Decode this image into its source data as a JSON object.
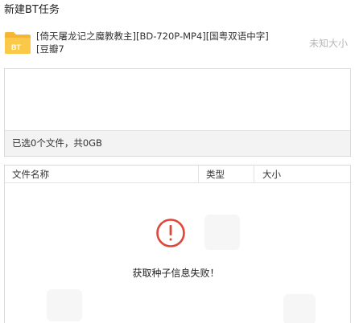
{
  "window": {
    "title": "新建BT任务"
  },
  "task": {
    "icon_label": "BT",
    "name": "[倚天屠龙记之魔教教主][BD-720P-MP4][国粤双语中字][豆瓣7",
    "size": "未知大小"
  },
  "selection": {
    "summary": "已选0个文件，共0GB"
  },
  "file_list": {
    "columns": [
      "文件名称",
      "类型",
      "大小"
    ],
    "rows": [],
    "error_message": "获取种子信息失败！"
  },
  "colors": {
    "folder": "#f5b733",
    "error": "#e0453a",
    "muted_text": "#b8b8b8"
  }
}
